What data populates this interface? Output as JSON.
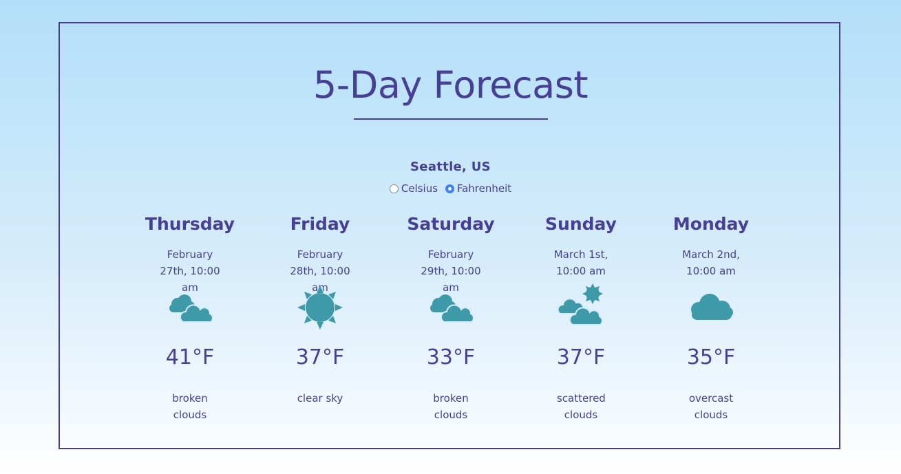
{
  "header": {
    "title": "5-Day Forecast"
  },
  "location": "Seattle, US",
  "units": {
    "options": [
      {
        "label": "Celsius",
        "checked": false
      },
      {
        "label": "Fahrenheit",
        "checked": true
      }
    ]
  },
  "colors": {
    "accent": "#463f93",
    "icon": "#3e9aa8",
    "radio_selected": "#3b82f6"
  },
  "forecast": [
    {
      "day": "Thursday",
      "date": "February 27th, 10:00 am",
      "icon": "broken-clouds-icon",
      "temp": "41°F",
      "description": "broken clouds"
    },
    {
      "day": "Friday",
      "date": "February 28th, 10:00 am",
      "icon": "sun-icon",
      "temp": "37°F",
      "description": "clear sky"
    },
    {
      "day": "Saturday",
      "date": "February 29th, 10:00 am",
      "icon": "broken-clouds-icon",
      "temp": "33°F",
      "description": "broken clouds"
    },
    {
      "day": "Sunday",
      "date": "March 1st, 10:00 am",
      "icon": "scattered-clouds-icon",
      "temp": "37°F",
      "description": "scattered clouds"
    },
    {
      "day": "Monday",
      "date": "March 2nd, 10:00 am",
      "icon": "overcast-clouds-icon",
      "temp": "35°F",
      "description": "overcast clouds"
    }
  ]
}
